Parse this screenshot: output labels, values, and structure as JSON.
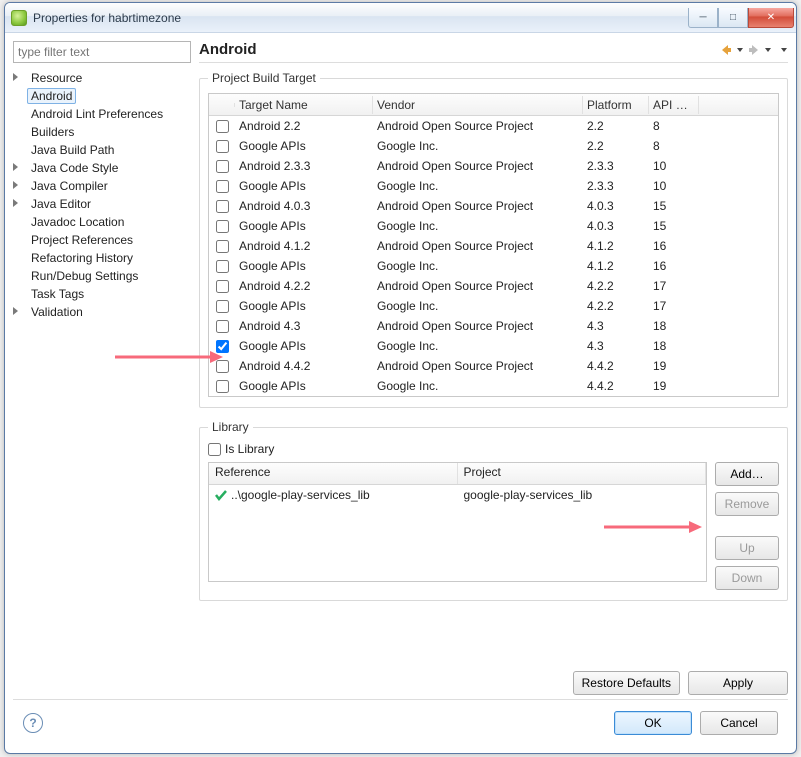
{
  "window": {
    "title": "Properties for habrtimezone"
  },
  "filter": {
    "placeholder": "type filter text"
  },
  "tree": {
    "items": [
      {
        "label": "Resource",
        "parent": true
      },
      {
        "label": "Android",
        "selected": true
      },
      {
        "label": "Android Lint Preferences"
      },
      {
        "label": "Builders"
      },
      {
        "label": "Java Build Path"
      },
      {
        "label": "Java Code Style",
        "parent": true
      },
      {
        "label": "Java Compiler",
        "parent": true
      },
      {
        "label": "Java Editor",
        "parent": true
      },
      {
        "label": "Javadoc Location"
      },
      {
        "label": "Project References"
      },
      {
        "label": "Refactoring History"
      },
      {
        "label": "Run/Debug Settings"
      },
      {
        "label": "Task Tags"
      },
      {
        "label": "Validation",
        "parent": true
      }
    ]
  },
  "page": {
    "heading": "Android",
    "build_target": {
      "legend": "Project Build Target",
      "columns": {
        "target": "Target Name",
        "vendor": "Vendor",
        "platform": "Platform",
        "api": "API Le…"
      },
      "rows": [
        {
          "target": "Android 2.2",
          "vendor": "Android Open Source Project",
          "platform": "2.2",
          "api": "8",
          "checked": false
        },
        {
          "target": "Google APIs",
          "vendor": "Google Inc.",
          "platform": "2.2",
          "api": "8",
          "checked": false
        },
        {
          "target": "Android 2.3.3",
          "vendor": "Android Open Source Project",
          "platform": "2.3.3",
          "api": "10",
          "checked": false
        },
        {
          "target": "Google APIs",
          "vendor": "Google Inc.",
          "platform": "2.3.3",
          "api": "10",
          "checked": false
        },
        {
          "target": "Android 4.0.3",
          "vendor": "Android Open Source Project",
          "platform": "4.0.3",
          "api": "15",
          "checked": false
        },
        {
          "target": "Google APIs",
          "vendor": "Google Inc.",
          "platform": "4.0.3",
          "api": "15",
          "checked": false
        },
        {
          "target": "Android 4.1.2",
          "vendor": "Android Open Source Project",
          "platform": "4.1.2",
          "api": "16",
          "checked": false
        },
        {
          "target": "Google APIs",
          "vendor": "Google Inc.",
          "platform": "4.1.2",
          "api": "16",
          "checked": false
        },
        {
          "target": "Android 4.2.2",
          "vendor": "Android Open Source Project",
          "platform": "4.2.2",
          "api": "17",
          "checked": false
        },
        {
          "target": "Google APIs",
          "vendor": "Google Inc.",
          "platform": "4.2.2",
          "api": "17",
          "checked": false
        },
        {
          "target": "Android 4.3",
          "vendor": "Android Open Source Project",
          "platform": "4.3",
          "api": "18",
          "checked": false
        },
        {
          "target": "Google APIs",
          "vendor": "Google Inc.",
          "platform": "4.3",
          "api": "18",
          "checked": true
        },
        {
          "target": "Android 4.4.2",
          "vendor": "Android Open Source Project",
          "platform": "4.4.2",
          "api": "19",
          "checked": false
        },
        {
          "target": "Google APIs",
          "vendor": "Google Inc.",
          "platform": "4.4.2",
          "api": "19",
          "checked": false
        }
      ]
    },
    "library": {
      "legend": "Library",
      "is_library_label": "Is Library",
      "is_library_checked": false,
      "columns": {
        "ref": "Reference",
        "proj": "Project"
      },
      "rows": [
        {
          "ref": "..\\google-play-services_lib",
          "proj": "google-play-services_lib",
          "ok": true
        }
      ],
      "buttons": {
        "add": "Add…",
        "remove": "Remove",
        "up": "Up",
        "down": "Down"
      }
    },
    "buttons": {
      "restore": "Restore Defaults",
      "apply": "Apply"
    }
  },
  "footer": {
    "ok": "OK",
    "cancel": "Cancel"
  }
}
